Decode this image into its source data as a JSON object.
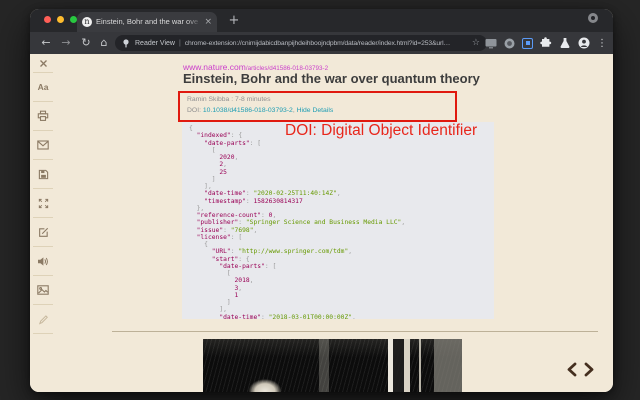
{
  "browser": {
    "tab": {
      "favicon_letter": "n",
      "title": "Einstein, Bohr and the war ove",
      "close_glyph": "×",
      "new_tab_glyph": "+"
    },
    "nav": {
      "back_glyph": "←",
      "forward_glyph": "→",
      "reload_glyph": "↻",
      "home_glyph": "⌂",
      "star_glyph": "☆",
      "menu_dots_glyph": "⋮",
      "extension_label": "Reader View",
      "separator": "|",
      "url": "chrome-extension://cnimijdabicdbanpijhdeihboojndpbm/data/reader/index.html?id=253&url…"
    },
    "toolbar_icons": [
      "screen-cast-icon",
      "badge-icon",
      "reader-view-icon",
      "puzzle-icon",
      "flask-icon",
      "avatar-icon",
      "menu-dots-icon"
    ]
  },
  "sidebar": {
    "font_button_label": "Aa",
    "icons": [
      "close-icon",
      "font-size-icon",
      "print-icon",
      "email-icon",
      "save-icon",
      "fullscreen-icon",
      "edit-icon",
      "speaker-icon",
      "images-icon",
      "highlight-pencil-icon"
    ]
  },
  "article": {
    "source": {
      "domain": "www.nature.com",
      "path": "/articles/d41586-018-03793-2"
    },
    "title": "Einstein, Bohr and the war over quantum theory",
    "byline": "Ramin Skibba : 7-8 minutes",
    "doi": {
      "label": "DOI: ",
      "link": "10.1038/d41586-018-03793-2",
      "separator": ", ",
      "hide_details": "Hide Details"
    },
    "annotation": "DOI: Digital Object Identifier",
    "code_lines": [
      "{",
      "  \"indexed\": {",
      "    \"date-parts\": [",
      "      [",
      "        2020,",
      "        2,",
      "        25",
      "      ]",
      "    ],",
      "    \"date-time\": \"2020-02-25T11:40:14Z\",",
      "    \"timestamp\": 1582630814317",
      "  },",
      "  \"reference-count\": 0,",
      "  \"publisher\": \"Springer Science and Business Media LLC\",",
      "  \"issue\": \"7698\",",
      "  \"license\": [",
      "    {",
      "      \"URL\": \"http://www.springer.com/tdm\",",
      "      \"start\": {",
      "        \"date-parts\": [",
      "          [",
      "            2018,",
      "            3,",
      "            1",
      "          ]",
      "        ],",
      "        \"date-time\": \"2018-03-01T00:00:00Z\","
    ]
  },
  "pager": {
    "prev_icon": "chevron-left-icon",
    "next_icon": "chevron-right-icon"
  },
  "colors": {
    "annotation_red": "#e0190f",
    "link_pink": "#cb3ecb",
    "doi_teal": "#1d9db4",
    "code_key": "#990055",
    "code_string": "#669900",
    "code_number": "#990055",
    "code_punctuation": "#999999",
    "reader_view_blue": "#5b9bf7",
    "content_background": "#f2e9d8",
    "code_background": "#e8e9ed"
  }
}
